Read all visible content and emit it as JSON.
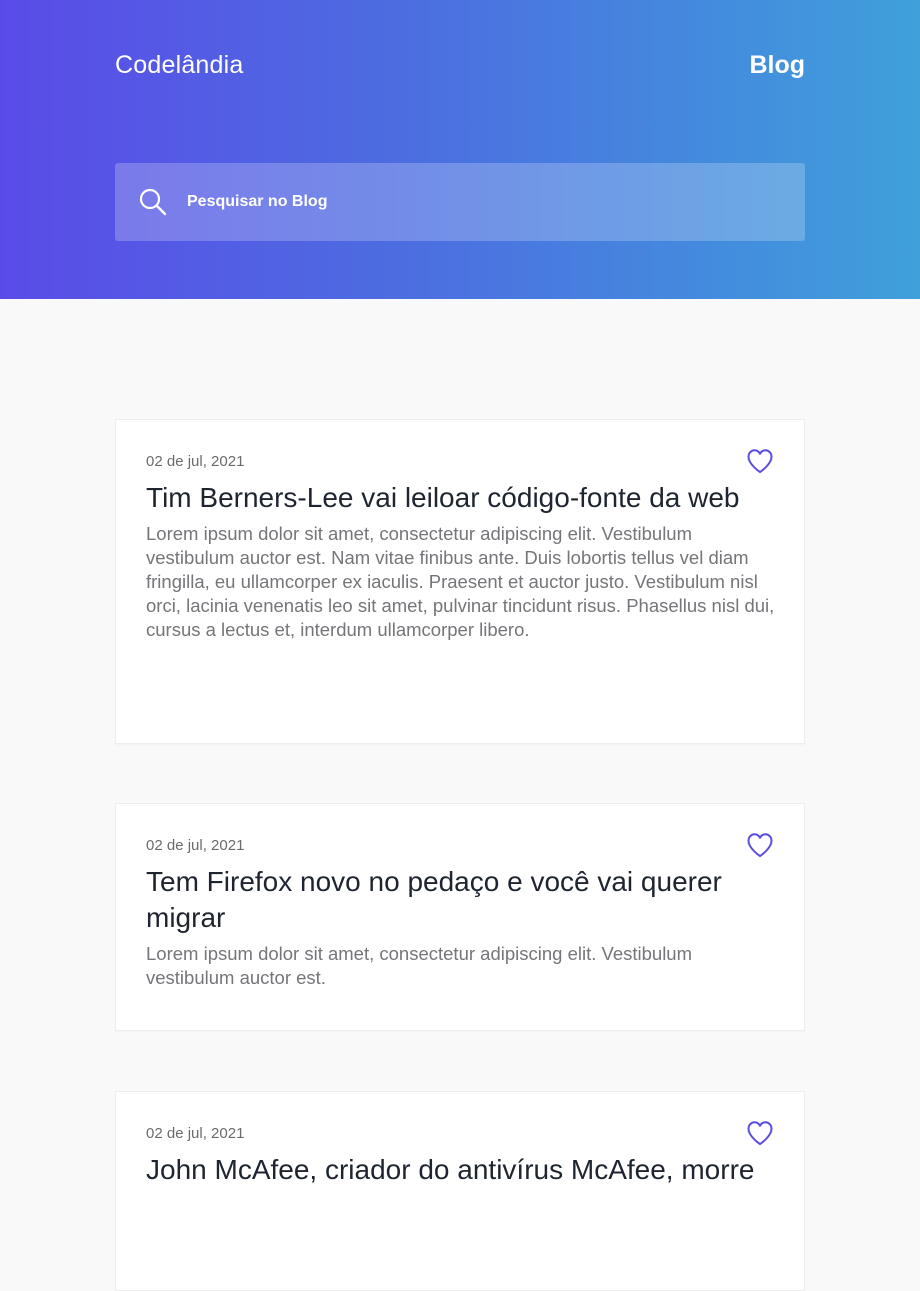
{
  "header": {
    "brand": "Codelândia",
    "nav_blog": "Blog",
    "search_placeholder": "Pesquisar no Blog"
  },
  "posts": [
    {
      "date": "02 de jul, 2021",
      "title": "Tim Berners-Lee vai leiloar código-fonte da web",
      "excerpt": "Lorem ipsum dolor sit amet, consectetur adipiscing elit. Vestibulum vestibulum auctor est. Nam vitae finibus ante. Duis lobortis tellus vel diam fringilla, eu ullamcorper ex iaculis. Praesent et auctor justo. Vestibulum nisl orci, lacinia venenatis leo sit amet, pulvinar tincidunt risus. Phasellus nisl dui, cursus a lectus et, interdum ullamcorper libero."
    },
    {
      "date": "02 de jul, 2021",
      "title": "Tem Firefox novo no pedaço e você vai querer migrar",
      "excerpt": "Lorem ipsum dolor sit amet, consectetur adipiscing elit. Vestibulum vestibulum auctor est."
    },
    {
      "date": "02 de jul, 2021",
      "title": "John McAfee, criador do antivírus McAfee, morre",
      "excerpt": ""
    }
  ],
  "icons": {
    "search": "search-icon",
    "favorite": "heart-outline-icon"
  },
  "colors": {
    "gradient_start": "#5a4be8",
    "gradient_end": "#3fa0da",
    "heart": "#5b4fd8",
    "page_background": "#f9f9f9"
  }
}
